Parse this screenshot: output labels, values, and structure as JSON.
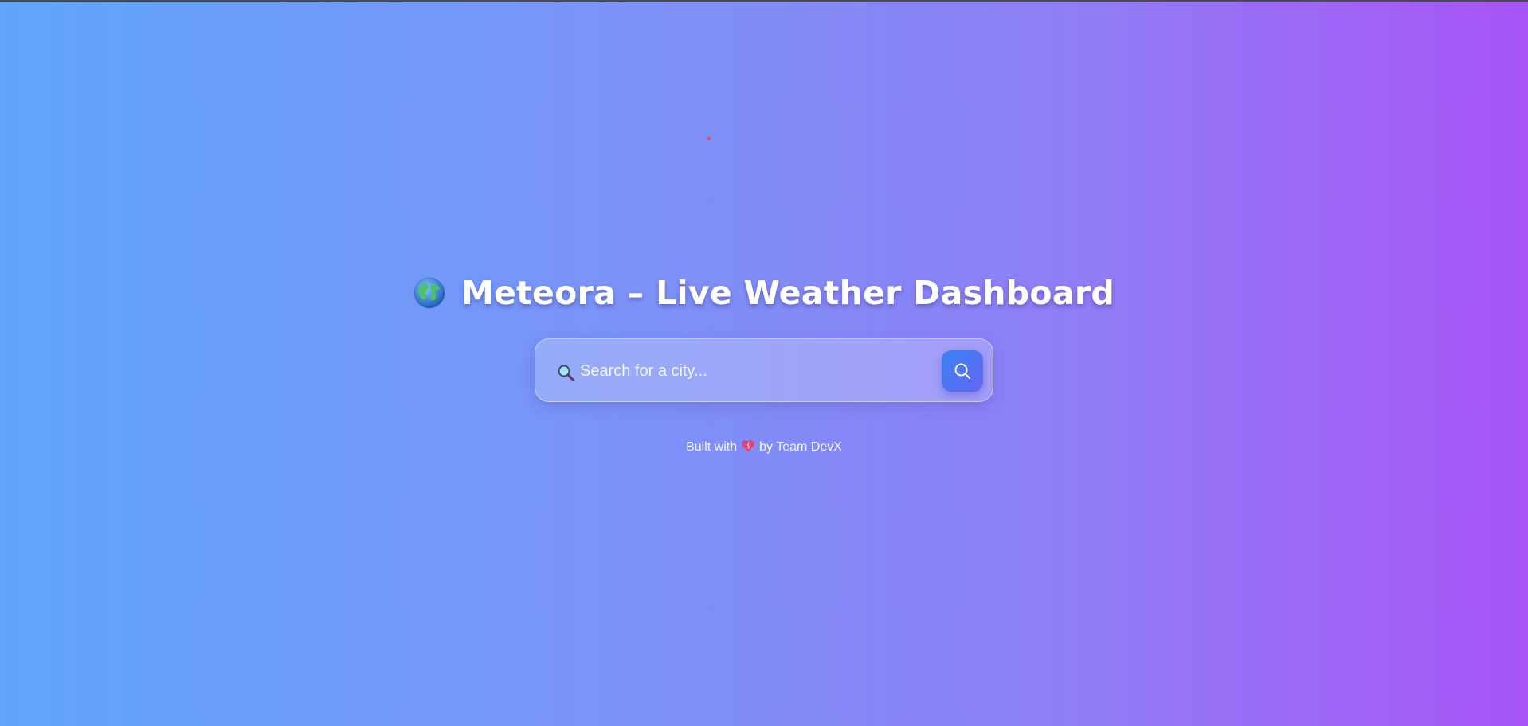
{
  "app": {
    "title": "Meteora – Live Weather Dashboard",
    "title_icon": "globe-icon"
  },
  "search": {
    "placeholder": "Search for a city...",
    "value": "",
    "leading_icon": "magnifier-icon",
    "button_icon": "search-icon"
  },
  "footer": {
    "prefix": "Built with",
    "icon": "heart-icon",
    "suffix": "by Team DevX"
  },
  "colors": {
    "gradient_start": "#60a5fa",
    "gradient_end": "#a855f7",
    "button_start": "#3b82f6",
    "button_end": "#6366f1"
  }
}
